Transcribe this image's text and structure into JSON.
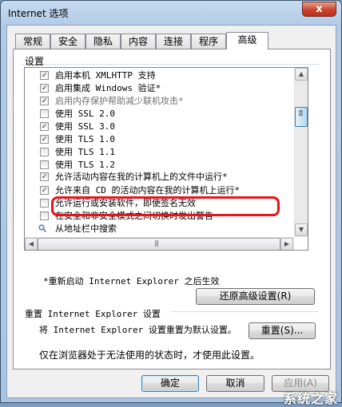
{
  "window": {
    "title": "Internet 选项",
    "close_label": "x"
  },
  "tabs": [
    "常规",
    "安全",
    "隐私",
    "内容",
    "连接",
    "程序",
    "高级"
  ],
  "active_tab": "高级",
  "settings_group": "设置",
  "settings": [
    {
      "label": "启用本机 XMLHTTP 支持",
      "checked": true,
      "disabled": false
    },
    {
      "label": "启用集成 Windows 验证*",
      "checked": true,
      "disabled": false
    },
    {
      "label": "启用内存保护帮助减少联机攻击*",
      "checked": true,
      "disabled": true
    },
    {
      "label": "使用 SSL 2.0",
      "checked": false,
      "disabled": false
    },
    {
      "label": "使用 SSL 3.0",
      "checked": true,
      "disabled": false
    },
    {
      "label": "使用 TLS 1.0",
      "checked": true,
      "disabled": false
    },
    {
      "label": "使用 TLS 1.1",
      "checked": false,
      "disabled": false
    },
    {
      "label": "使用 TLS 1.2",
      "checked": false,
      "disabled": false
    },
    {
      "label": "允许活动内容在我的计算机上的文件中运行*",
      "checked": true,
      "disabled": false
    },
    {
      "label": "允许来自 CD 的活动内容在我的计算机上运行*",
      "checked": true,
      "disabled": false
    },
    {
      "label": "允许运行或安装软件，即使签名无效",
      "checked": false,
      "disabled": false
    },
    {
      "label": "在安全和非安全模式之间切换时发出警告",
      "checked": false,
      "disabled": false
    },
    {
      "label": "从地址栏中搜索",
      "checked": null,
      "disabled": false
    }
  ],
  "note": "*重新启动 Internet Explorer 之后生效",
  "restore_button": "还原高级设置(R)",
  "reset_section": {
    "title": "重置 Internet Explorer 设置",
    "description": "将 Internet Explorer 设置重置为默认设置。",
    "button": "重置(S)...",
    "hint": "仅在浏览器处于无法使用的状态时，才使用此设置。"
  },
  "footer": {
    "ok": "确定",
    "cancel": "取消",
    "apply": "应用(A)"
  },
  "watermark": "系统之家",
  "colors": {
    "highlight": "#e8141c",
    "close": "#c9432c"
  },
  "scroll": {
    "vertical_fraction": 0.25
  }
}
